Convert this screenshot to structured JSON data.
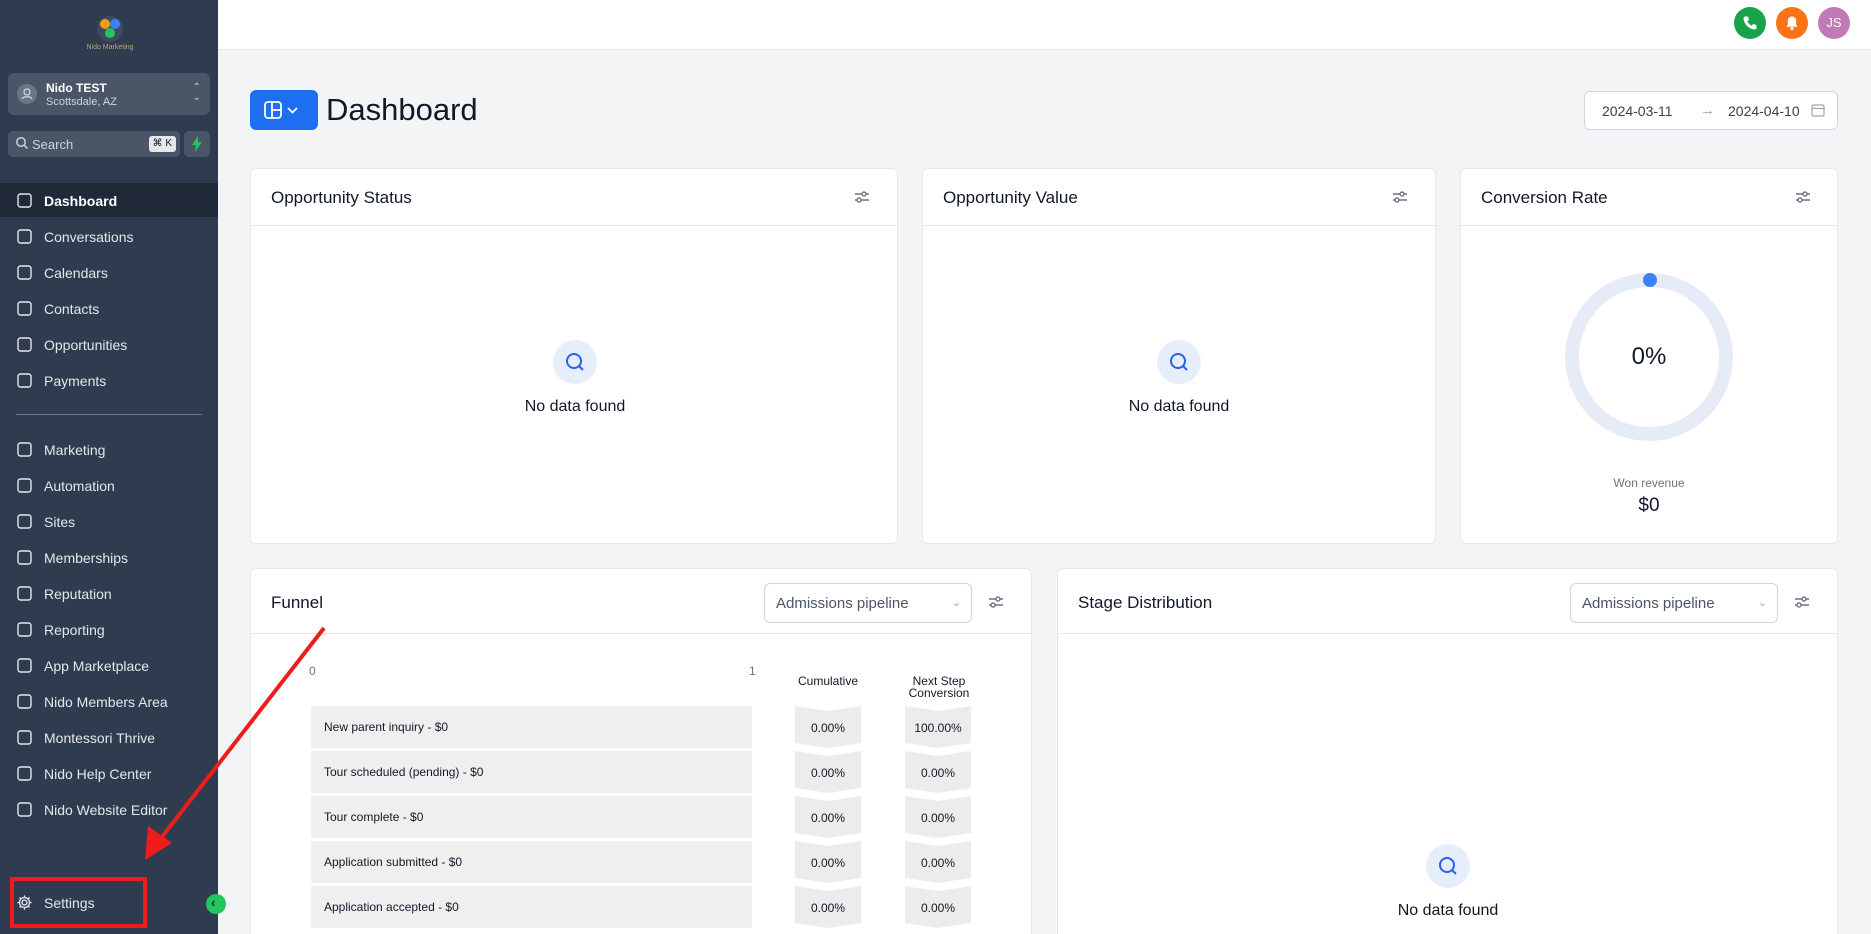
{
  "brand": {
    "logo_text": "Nido Marketing"
  },
  "account": {
    "name": "Nido TEST",
    "location": "Scottsdale, AZ"
  },
  "search": {
    "placeholder": "Search",
    "shortcut": "⌘ K"
  },
  "nav": {
    "items": [
      {
        "label": "Dashboard",
        "icon": "dashboard-icon",
        "active": true
      },
      {
        "label": "Conversations",
        "icon": "chat-icon"
      },
      {
        "label": "Calendars",
        "icon": "calendar-icon"
      },
      {
        "label": "Contacts",
        "icon": "contacts-icon"
      },
      {
        "label": "Opportunities",
        "icon": "opportunities-icon"
      },
      {
        "label": "Payments",
        "icon": "receipt-icon"
      },
      {
        "label": "Marketing",
        "icon": "send-icon"
      },
      {
        "label": "Automation",
        "icon": "automation-icon"
      },
      {
        "label": "Sites",
        "icon": "globe-icon"
      },
      {
        "label": "Memberships",
        "icon": "graduation-icon"
      },
      {
        "label": "Reputation",
        "icon": "star-icon"
      },
      {
        "label": "Reporting",
        "icon": "trend-icon"
      },
      {
        "label": "App Marketplace",
        "icon": "apps-icon"
      },
      {
        "label": "Nido Members Area",
        "icon": "users-icon"
      },
      {
        "label": "Montessori Thrive",
        "icon": "leaf-icon"
      },
      {
        "label": "Nido Help Center",
        "icon": "help-users-icon"
      },
      {
        "label": "Nido Website Editor",
        "icon": "wrench-icon"
      }
    ],
    "settings": {
      "label": "Settings",
      "icon": "gear-icon"
    }
  },
  "topbar": {
    "avatar_initials": "JS",
    "phone_color": "#16a34a",
    "bell_color": "#f97316"
  },
  "header": {
    "title": "Dashboard",
    "date_start": "2024-03-11",
    "date_end": "2024-04-10",
    "arrow": "→"
  },
  "cards": {
    "opportunity_status": {
      "title": "Opportunity Status",
      "empty": "No data found"
    },
    "opportunity_value": {
      "title": "Opportunity Value",
      "empty": "No data found"
    },
    "conversion_rate": {
      "title": "Conversion Rate",
      "value": "0%",
      "won_label": "Won revenue",
      "won_value": "$0",
      "fraction": 0
    },
    "funnel": {
      "title": "Funnel",
      "pipeline": "Admissions pipeline",
      "axis_min": "0",
      "axis_max": "1",
      "col_cumulative": "Cumulative",
      "col_next_line1": "Next Step",
      "col_next_line2": "Conversion",
      "rows": [
        {
          "label": "New parent inquiry - $0",
          "cumulative": "0.00%",
          "next": "100.00%"
        },
        {
          "label": "Tour scheduled (pending) - $0",
          "cumulative": "0.00%",
          "next": "0.00%"
        },
        {
          "label": "Tour complete - $0",
          "cumulative": "0.00%",
          "next": "0.00%"
        },
        {
          "label": "Application submitted - $0",
          "cumulative": "0.00%",
          "next": "0.00%"
        },
        {
          "label": "Application accepted - $0",
          "cumulative": "0.00%",
          "next": "0.00%"
        }
      ]
    },
    "stage_distribution": {
      "title": "Stage Distribution",
      "pipeline": "Admissions pipeline",
      "empty": "No data found"
    }
  },
  "colors": {
    "accent": "#1d6ef0",
    "sidebar": "#2f3c4f",
    "annotation": "#ef1c1c"
  }
}
